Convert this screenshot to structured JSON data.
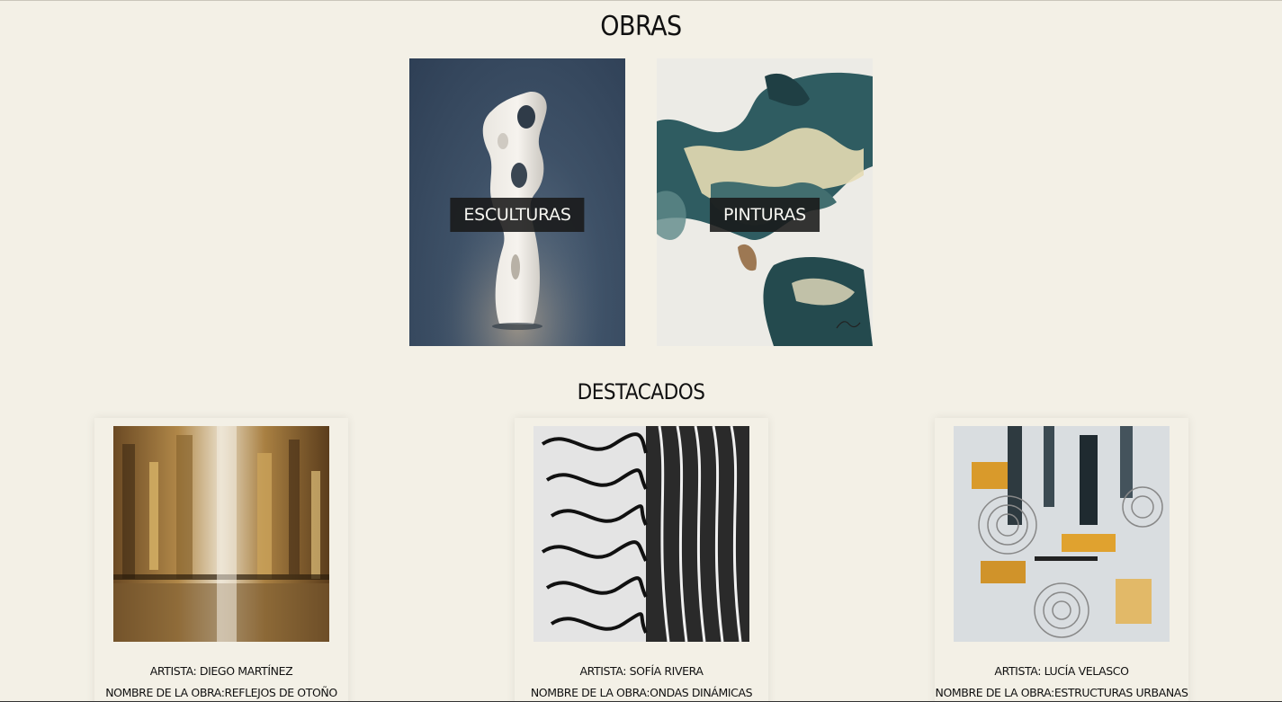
{
  "sections": {
    "obras_title": "OBRAS",
    "destacados_title": "DESTACADOS"
  },
  "categories": [
    {
      "label": "ESCULTURAS",
      "image": "sculpture-image"
    },
    {
      "label": "PINTURAS",
      "image": "painting-image"
    }
  ],
  "featured": [
    {
      "artist": "ARTISTA: DIEGO MARTÍNEZ",
      "work": "NOMBRE DE LA OBRA:REFLEJOS DE OTOÑO",
      "image": "golden-abstract-painting"
    },
    {
      "artist": "ARTISTA: SOFÍA RIVERA",
      "work": "NOMBRE DE LA OBRA:ONDAS DINÁMICAS",
      "image": "black-white-waves-sculpture"
    },
    {
      "artist": "ARTISTA: LUCÍA VELASCO",
      "work": "NOMBRE DE LA OBRA:ESTRUCTURAS URBANAS",
      "image": "urban-abstract-painting"
    }
  ],
  "colors": {
    "background": "#f3f0e6",
    "label_bg": "#191919",
    "text": "#111111"
  }
}
